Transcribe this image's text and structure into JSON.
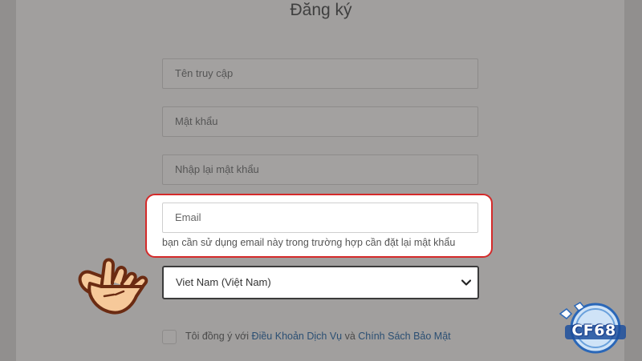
{
  "form": {
    "title": "Đăng ký",
    "username_placeholder": "Tên truy cập",
    "password_placeholder": "Mật khẩu",
    "confirm_password_placeholder": "Nhập lại mật khẩu",
    "email_placeholder": "Email",
    "email_hint": "bạn cần sử dụng email này trong trường hợp cần đặt lại mật khẩu",
    "country_selected": "Viet Nam (Việt Nam)",
    "terms_prefix": "Tôi đồng ý với ",
    "terms_link": "Điều Khoản Dịch Vụ",
    "terms_and": " và ",
    "privacy_link": "Chính Sách Bảo Mật"
  },
  "logo": {
    "text": "CF68"
  },
  "colors": {
    "highlight": "#d42a2a",
    "overlay": "#a19f9e",
    "link": "#2b4f73",
    "hand_fill": "#f6c99a",
    "hand_outline": "#6b2b12"
  },
  "icons": [
    "chevron-down-icon",
    "pointing-hand-icon",
    "cf68-logo-icon"
  ]
}
